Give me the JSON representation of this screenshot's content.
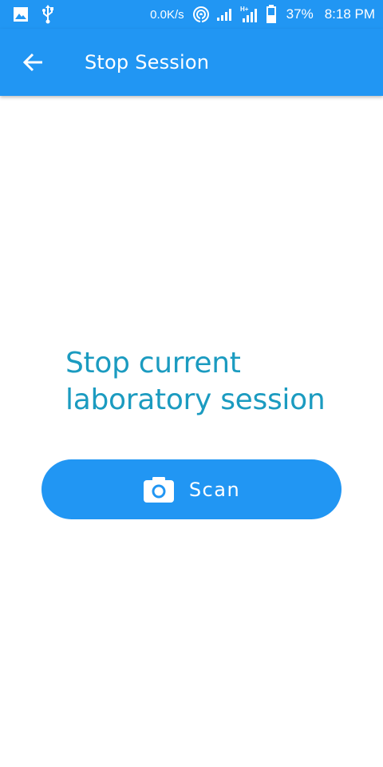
{
  "status_bar": {
    "net_speed": "0.0K/s",
    "battery_percent": "37%",
    "time": "8:18 PM",
    "icons": [
      "image-icon",
      "usb-icon",
      "hotspot-icon",
      "signal-icon",
      "signal-h-plus-icon",
      "battery-icon"
    ]
  },
  "app_bar": {
    "title": "Stop Session",
    "back_icon": "arrow-back-icon",
    "color": "#2196F3"
  },
  "main": {
    "headline": "Stop current laboratory session",
    "headline_color": "#1B9BC0"
  },
  "scan_button": {
    "label": "Scan",
    "icon": "camera-icon",
    "color": "#2196F3"
  }
}
